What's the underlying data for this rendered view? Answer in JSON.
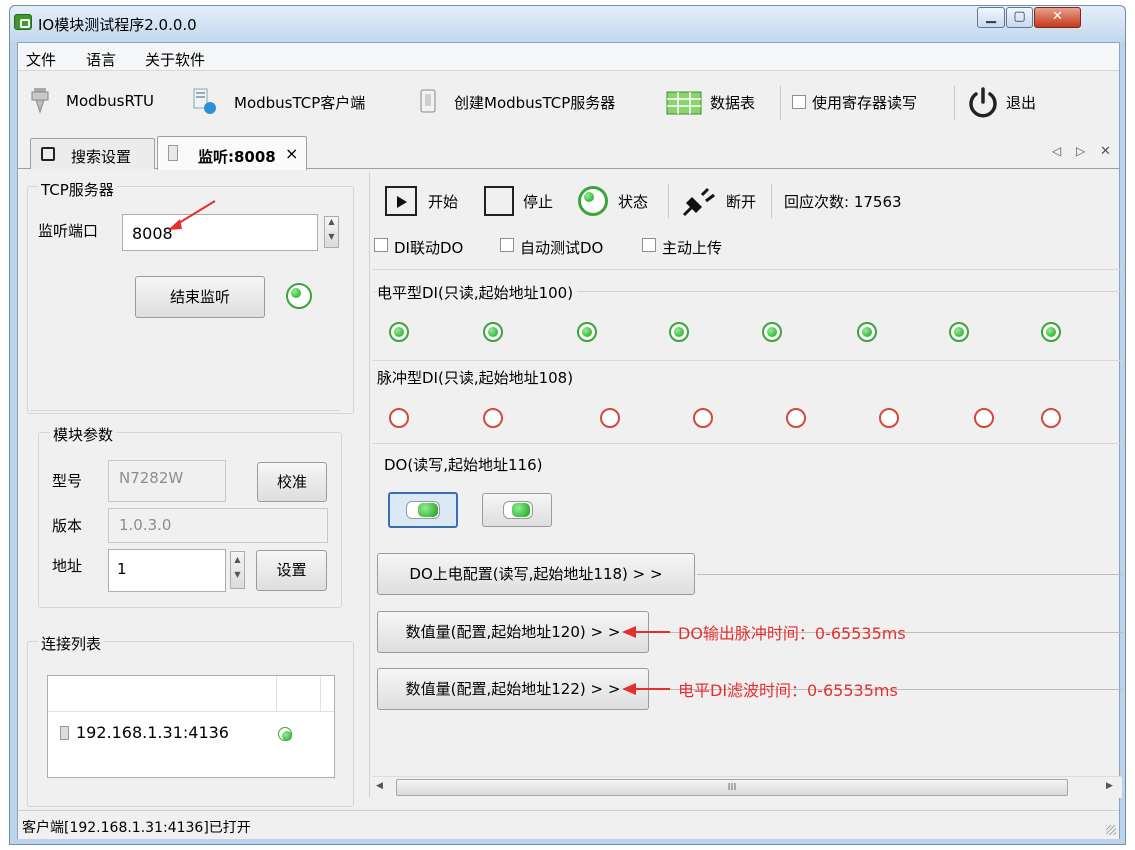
{
  "window": {
    "title": "IO模块测试程序2.0.0.0"
  },
  "menu": [
    "文件",
    "语言",
    "关于软件"
  ],
  "toolbar": {
    "modbus_rtu": "ModbusRTU",
    "modbus_tcp_client": "ModbusTCP客户端",
    "create_server": "创建ModbusTCP服务器",
    "data_table": "数据表",
    "use_register": "使用寄存器读写",
    "exit": "退出"
  },
  "tabs": [
    {
      "label": "搜索设置"
    },
    {
      "label": "监听:8008",
      "close": "×"
    }
  ],
  "tab_nav": {
    "left": "◁",
    "right": "▷",
    "close": "✕"
  },
  "tcp_server": {
    "title": "TCP服务器",
    "port_label": "监听端口",
    "port_value": "8008",
    "stop_button": "结束监听"
  },
  "module": {
    "title": "模块参数",
    "model_label": "型号",
    "model_value": "N7282W",
    "calibrate": "校准",
    "version_label": "版本",
    "version_value": "1.0.3.0",
    "address_label": "地址",
    "address_value": "1",
    "set": "设置"
  },
  "connections": {
    "title": "连接列表",
    "items": [
      {
        "address": "192.168.1.31:4136"
      }
    ]
  },
  "controls": {
    "start": "开始",
    "stop": "停止",
    "status": "状态",
    "disconnect": "断开",
    "response_count": "回应次数: 17563",
    "di_link_do": "DI联动DO",
    "auto_test_do": "自动测试DO",
    "active_upload": "主动上传"
  },
  "di_level": {
    "title": "电平型DI(只读,起始地址100)",
    "states": [
      1,
      1,
      1,
      1,
      1,
      1,
      1,
      1
    ]
  },
  "di_pulse": {
    "title": "脉冲型DI(只读,起始地址108)",
    "states": [
      0,
      0,
      0,
      0,
      0,
      0,
      0,
      0
    ]
  },
  "do": {
    "title": "DO(读写,起始地址116)",
    "states": [
      1,
      1
    ]
  },
  "buttons": {
    "do_poweron": "DO上电配置(读写,起始地址118) > >",
    "numeric_120": "数值量(配置,起始地址120) > >",
    "numeric_122": "数值量(配置,起始地址122) > >"
  },
  "annotations": {
    "note_120": "DO输出脉冲时间：0-65535ms",
    "note_122": "电平DI滤波时间：0-65535ms"
  },
  "scrollbar": {
    "thumb": "III"
  },
  "status_bar": {
    "text": "客户端[192.168.1.31:4136]已打开"
  },
  "colors": {
    "led_on": "#1b9c1b",
    "led_off": "#d24a3c",
    "annotation": "#e4302c"
  }
}
